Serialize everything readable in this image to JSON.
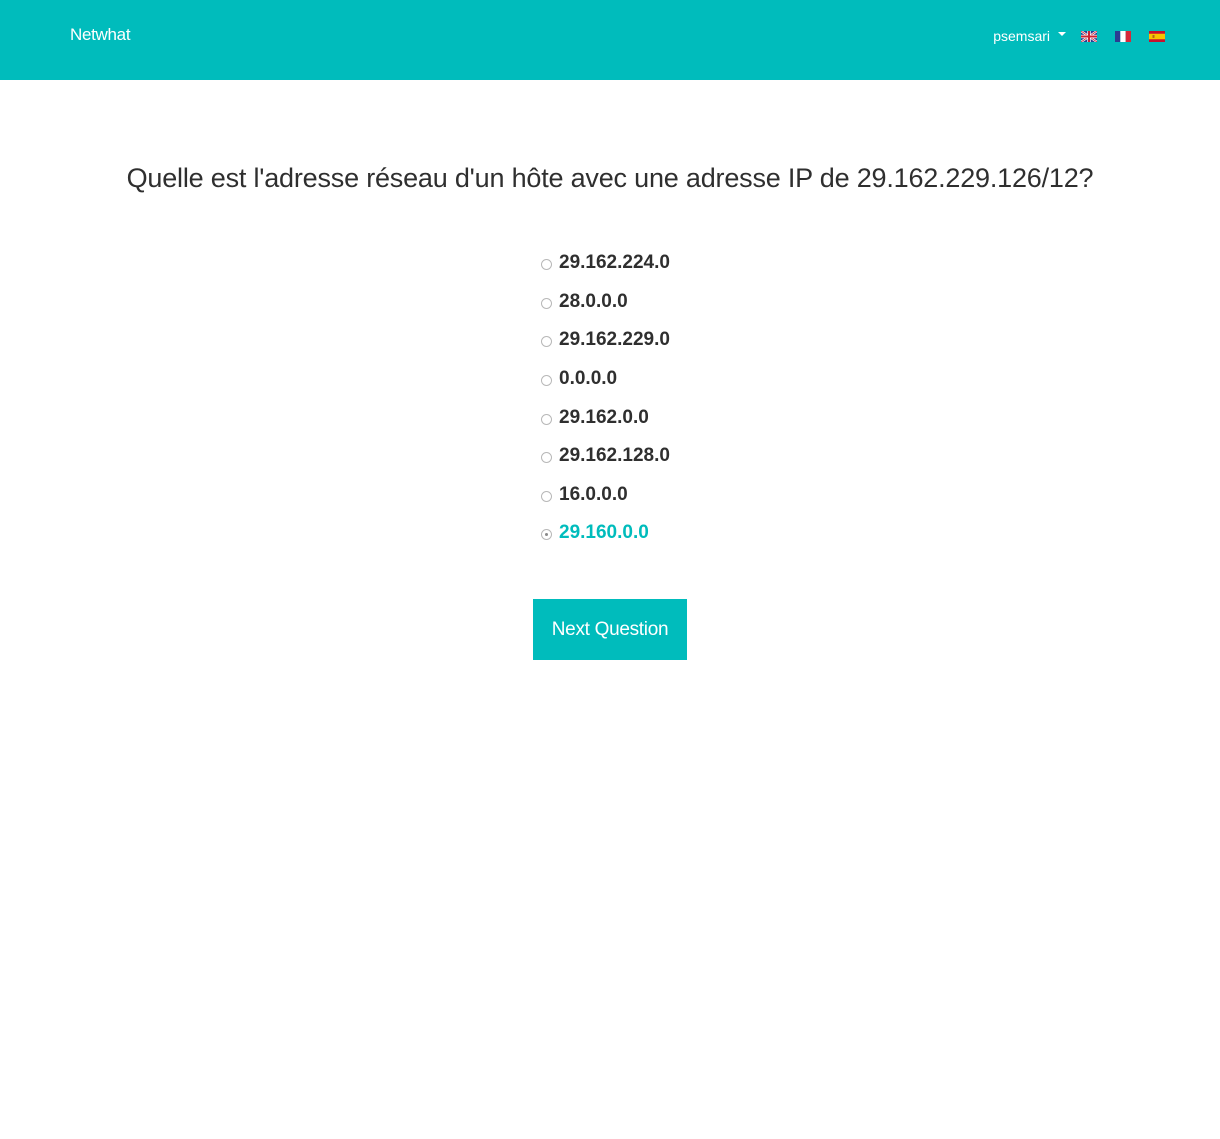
{
  "navbar": {
    "brand": "Netwhat",
    "username": "psemsari",
    "languages": [
      {
        "icon": "uk-flag-icon"
      },
      {
        "icon": "france-flag-icon"
      },
      {
        "icon": "spain-flag-icon"
      }
    ],
    "background_color": "#00bcbc"
  },
  "quiz": {
    "question": "Quelle est l'adresse réseau d'un hôte avec une adresse IP de 29.162.229.126/12?",
    "answers": [
      {
        "label": "29.162.224.0",
        "selected": false
      },
      {
        "label": "28.0.0.0",
        "selected": false
      },
      {
        "label": "29.162.229.0",
        "selected": false
      },
      {
        "label": "0.0.0.0",
        "selected": false
      },
      {
        "label": "29.162.0.0",
        "selected": false
      },
      {
        "label": "29.162.128.0",
        "selected": false
      },
      {
        "label": "16.0.0.0",
        "selected": false
      },
      {
        "label": "29.160.0.0",
        "selected": true
      }
    ],
    "selected_color": "#00bcbc",
    "next_button_label": "Next Question"
  }
}
